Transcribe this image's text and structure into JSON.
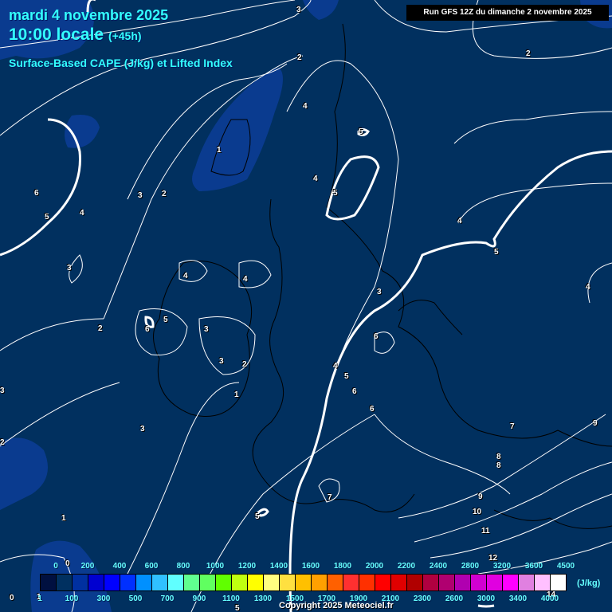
{
  "header": {
    "date": "mardi 4 novembre 2025",
    "time": "10:00 locale",
    "lead": "(+45h)",
    "parameter": "Surface-Based CAPE (J/kg) et Lifted Index",
    "run": "Run GFS 12Z du dimanche 2 novembre 2025"
  },
  "legend": {
    "unit": "(J/kg)",
    "colors": [
      "#001040",
      "#003060",
      "#0030a0",
      "#0000d0",
      "#0000ff",
      "#0030ff",
      "#0090ff",
      "#30c0ff",
      "#60ffff",
      "#60ff90",
      "#60ff60",
      "#60ff00",
      "#c0ff10",
      "#ffff00",
      "#ffff80",
      "#ffe040",
      "#ffc000",
      "#ffa000",
      "#ff6000",
      "#ff3030",
      "#ff3000",
      "#ff0000",
      "#e00000",
      "#b00000",
      "#b00040",
      "#b00070",
      "#b000b0",
      "#d000d0",
      "#e000e0",
      "#ff00ff",
      "#e080e0",
      "#ffc0ff",
      "#ffffff"
    ],
    "top_labels": [
      "0",
      "200",
      "400",
      "600",
      "800",
      "1000",
      "1200",
      "1400",
      "1600",
      "1800",
      "2000",
      "2200",
      "2400",
      "2800",
      "3200",
      "3600",
      "4500"
    ],
    "bottom_labels": [
      "1",
      "100",
      "300",
      "500",
      "700",
      "900",
      "1100",
      "1300",
      "1500",
      "1700",
      "1900",
      "2100",
      "2300",
      "2600",
      "3000",
      "3400",
      "4000"
    ]
  },
  "lifted_index_labels": [
    "3",
    "2",
    "2",
    "4",
    "5",
    "5",
    "4",
    "1",
    "6",
    "5",
    "4",
    "3",
    "2",
    "4",
    "5",
    "4",
    "3",
    "4",
    "4",
    "5",
    "3",
    "3",
    "2",
    "6",
    "3",
    "1",
    "6",
    "5",
    "6",
    "4",
    "3",
    "7",
    "1",
    "0",
    "5",
    "7",
    "8",
    "8",
    "9",
    "9",
    "10",
    "11",
    "12",
    "0",
    "1",
    "6",
    "2",
    "2",
    "3",
    "14",
    "5"
  ],
  "copyright": "Copyright 2025 Meteociel.fr"
}
